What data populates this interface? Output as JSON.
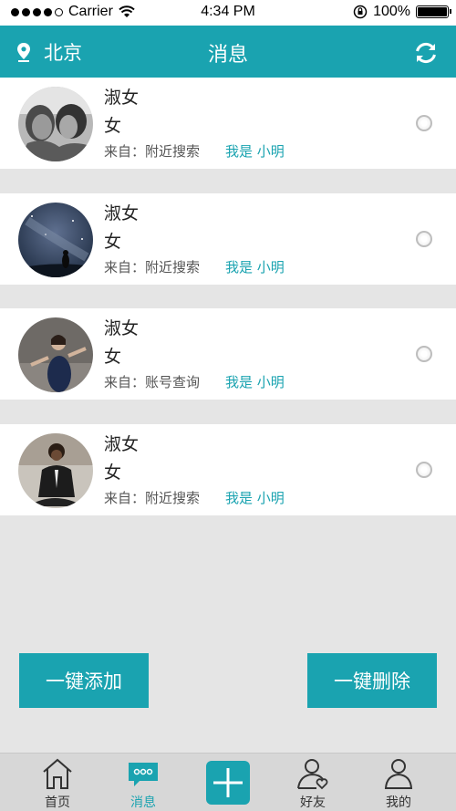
{
  "status": {
    "carrier": "Carrier",
    "time": "4:34 PM",
    "battery": "100%"
  },
  "header": {
    "location": "北京",
    "title": "消息"
  },
  "items": [
    {
      "name": "淑女",
      "gender": "女",
      "source": "来自：附近搜索",
      "message": "我是 小明"
    },
    {
      "name": "淑女",
      "gender": "女",
      "source": "来自：附近搜索",
      "message": "我是 小明"
    },
    {
      "name": "淑女",
      "gender": "女",
      "source": "来自：账号查询",
      "message": "我是 小明"
    },
    {
      "name": "淑女",
      "gender": "女",
      "source": "来自：附近搜索",
      "message": "我是 小明"
    }
  ],
  "actions": {
    "add_all": "一键添加",
    "delete_all": "一键删除"
  },
  "tabs": [
    {
      "label": "首页",
      "icon": "home-icon"
    },
    {
      "label": "消息",
      "icon": "chat-icon"
    },
    {
      "label": "",
      "icon": "plus-icon"
    },
    {
      "label": "好友",
      "icon": "friends-icon"
    },
    {
      "label": "我的",
      "icon": "profile-icon"
    }
  ],
  "colors": {
    "accent": "#1aa3b0",
    "background": "#e5e5e5"
  }
}
